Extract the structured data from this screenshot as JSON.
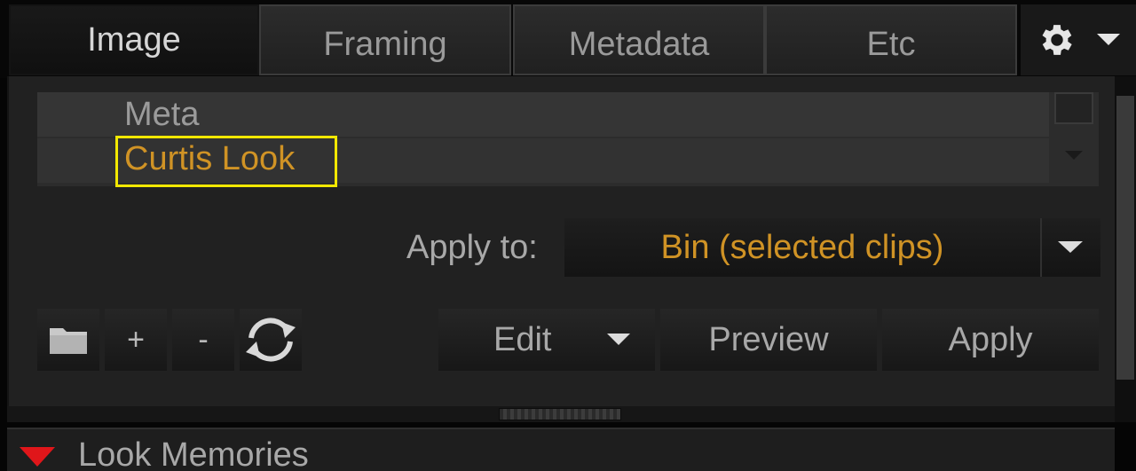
{
  "tabs": [
    {
      "label": "Image",
      "active": true
    },
    {
      "label": "Framing",
      "active": false
    },
    {
      "label": "Metadata",
      "active": false
    },
    {
      "label": "Etc",
      "active": false
    }
  ],
  "looks": {
    "items": [
      "Meta",
      "Curtis Look"
    ],
    "selected": "Curtis Look"
  },
  "apply_to": {
    "label": "Apply to:",
    "value": "Bin (selected clips)"
  },
  "toolbar": {
    "folder_icon": "folder-icon",
    "add_label": "+",
    "remove_label": "-",
    "refresh_icon": "refresh-icon",
    "edit_label": "Edit",
    "preview_label": "Preview",
    "apply_label": "Apply"
  },
  "footer": {
    "label": "Look Memories"
  },
  "colors": {
    "accent_orange": "#d09325",
    "highlight_yellow": "#f2e800",
    "expand_red": "#e0161a"
  }
}
